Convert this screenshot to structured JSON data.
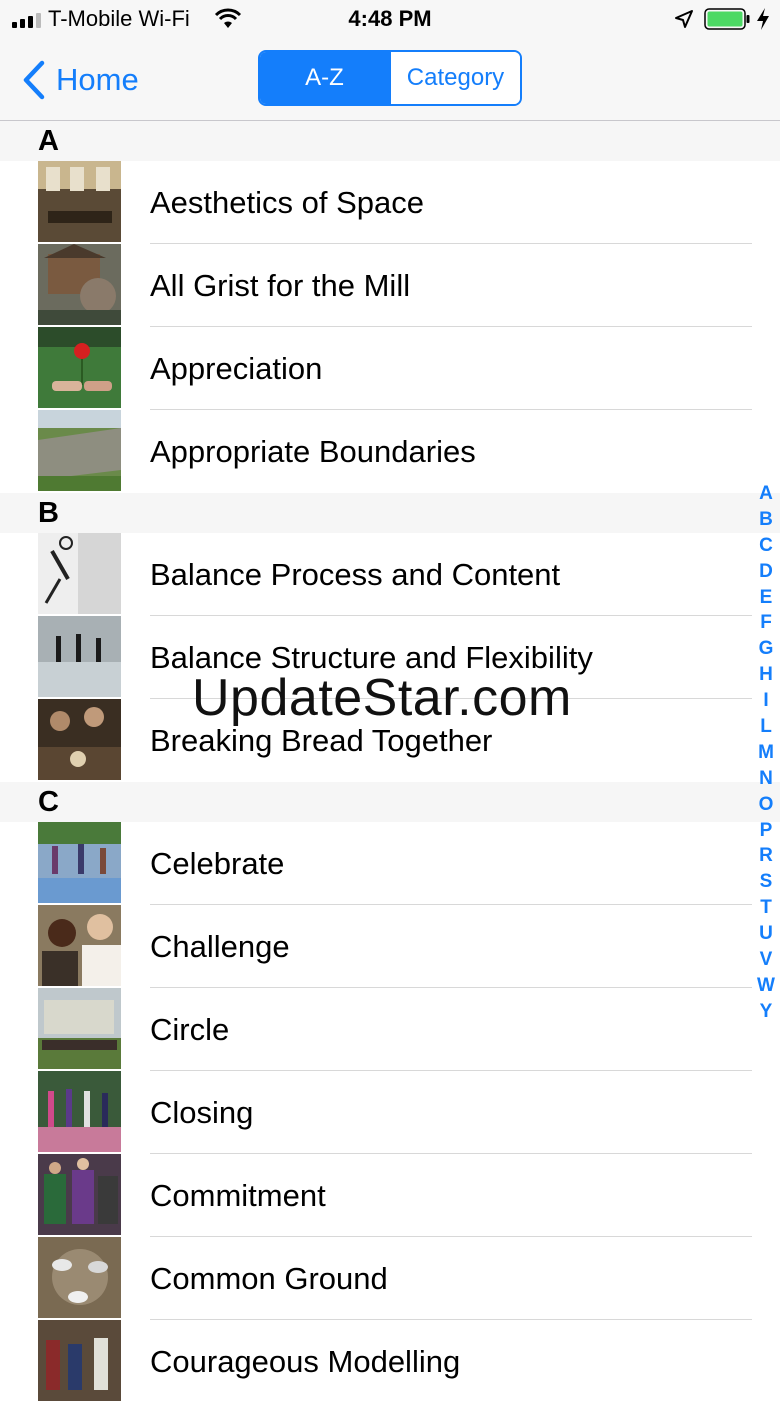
{
  "status_bar": {
    "carrier": "T-Mobile Wi-Fi",
    "time": "4:48 PM",
    "icons": [
      "signal-icon",
      "wifi-icon",
      "location-arrow-icon",
      "battery-icon",
      "charging-bolt-icon"
    ]
  },
  "nav": {
    "back_label": "Home",
    "segments": [
      "A-Z",
      "Category"
    ],
    "selected_segment": "A-Z",
    "accent_color": "#147efb"
  },
  "sections": [
    {
      "letter": "A",
      "items": [
        "Aesthetics of Space",
        "All Grist for the Mill",
        "Appreciation",
        "Appropriate Boundaries"
      ]
    },
    {
      "letter": "B",
      "items": [
        "Balance Process and Content",
        "Balance Structure and Flexibility",
        "Breaking Bread Together"
      ]
    },
    {
      "letter": "C",
      "items": [
        "Celebrate",
        "Challenge",
        "Circle",
        "Closing",
        "Commitment",
        "Common Ground",
        "Courageous Modelling"
      ]
    }
  ],
  "index_letters": [
    "A",
    "B",
    "C",
    "D",
    "E",
    "F",
    "G",
    "H",
    "I",
    "L",
    "M",
    "N",
    "O",
    "P",
    "R",
    "S",
    "T",
    "U",
    "V",
    "W",
    "Y"
  ],
  "watermark": "UpdateStar.com"
}
